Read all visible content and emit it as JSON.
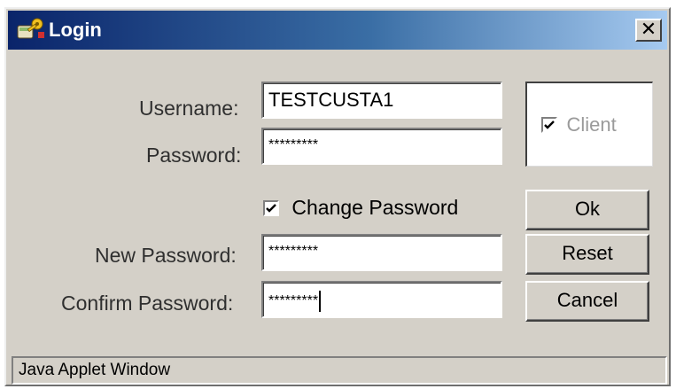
{
  "window": {
    "title": "Login",
    "close_label": "✕",
    "icon": "key-icon",
    "title_gradient": [
      "#0a246a",
      "#a6caf0"
    ]
  },
  "form": {
    "username_label": "Username:",
    "username_value": "TESTCUSTA1",
    "password_label": "Password:",
    "password_value": "*********",
    "change_password_label": "Change Password",
    "change_password_checked": true,
    "new_password_label": "New Password:",
    "new_password_value": "*********",
    "confirm_password_label": "Confirm Password:",
    "confirm_password_value": "*********"
  },
  "client": {
    "label": "Client",
    "checked": true,
    "disabled": true
  },
  "buttons": {
    "ok": "Ok",
    "reset": "Reset",
    "cancel": "Cancel"
  },
  "status": {
    "text": "Java Applet Window"
  }
}
